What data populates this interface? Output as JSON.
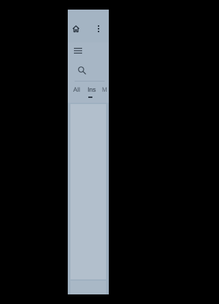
{
  "toolbar": {
    "home_icon": "home-icon",
    "more_icon": "more-vertical-icon"
  },
  "drawer": {
    "menu_icon": "hamburger-menu-icon"
  },
  "search": {
    "icon": "search-icon",
    "placeholder": ""
  },
  "tabs": [
    {
      "label": "All",
      "selected": false
    },
    {
      "label": "Ins",
      "selected": true
    },
    {
      "label": "M",
      "selected": false
    }
  ],
  "colors": {
    "screen_bg": "#9fb0c0",
    "content_bg": "#b2bfcc",
    "icon": "#1f2a35"
  }
}
